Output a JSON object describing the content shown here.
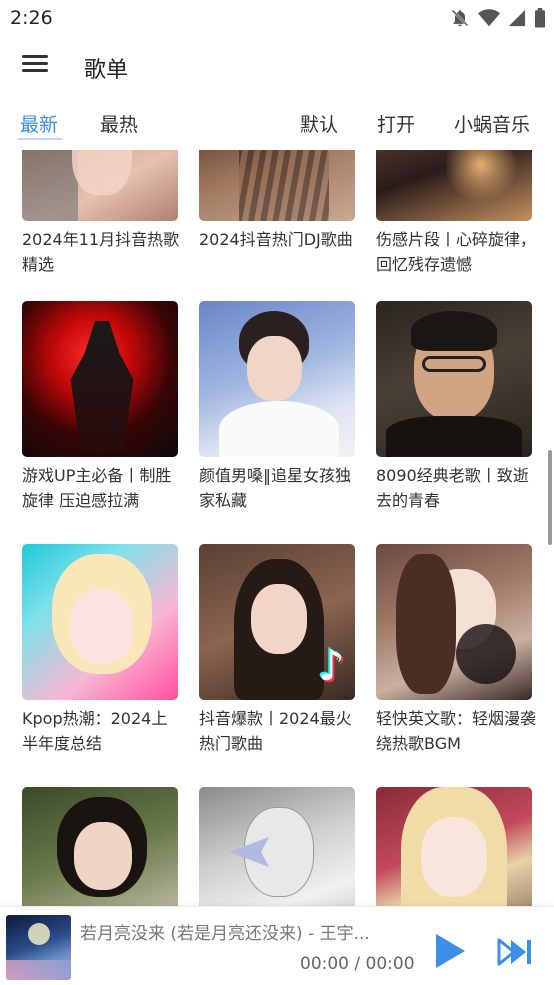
{
  "status": {
    "time": "2:26",
    "icons": [
      "notifications-off-icon",
      "wifi-icon",
      "signal-icon",
      "battery-icon"
    ]
  },
  "app_bar": {
    "title": "歌单",
    "menu_icon": "menu-icon"
  },
  "tabs": [
    {
      "label": "最新",
      "active": true
    },
    {
      "label": "最热",
      "active": false
    }
  ],
  "actions": {
    "default": "默认",
    "open": "打开",
    "source": "小蜗音乐"
  },
  "playlists": [
    {
      "title": "2024年11月抖音热歌精选"
    },
    {
      "title": "2024抖音热门DJ歌曲"
    },
    {
      "title": "伤感片段丨心碎旋律，回忆残存遗憾"
    },
    {
      "title": "游戏UP主必备丨制胜旋律 压迫感拉满"
    },
    {
      "title": "颜值男嗓‖追星女孩独家私藏"
    },
    {
      "title": "8090经典老歌丨致逝去的青春"
    },
    {
      "title": "Kpop热潮：2024上半年度总结"
    },
    {
      "title": "抖音爆款丨2024最火热门歌曲"
    },
    {
      "title": "轻快英文歌：轻烟漫袭绕热歌BGM"
    },
    {
      "title": ""
    },
    {
      "title": ""
    },
    {
      "title": ""
    }
  ],
  "player": {
    "song": "若月亮没来 (若是月亮还没来) - 王宇...",
    "time": "00:00 / 00:00",
    "play_icon": "play-icon",
    "next_icon": "skip-next-icon"
  },
  "colors": {
    "accent": "#3c8ee8"
  }
}
